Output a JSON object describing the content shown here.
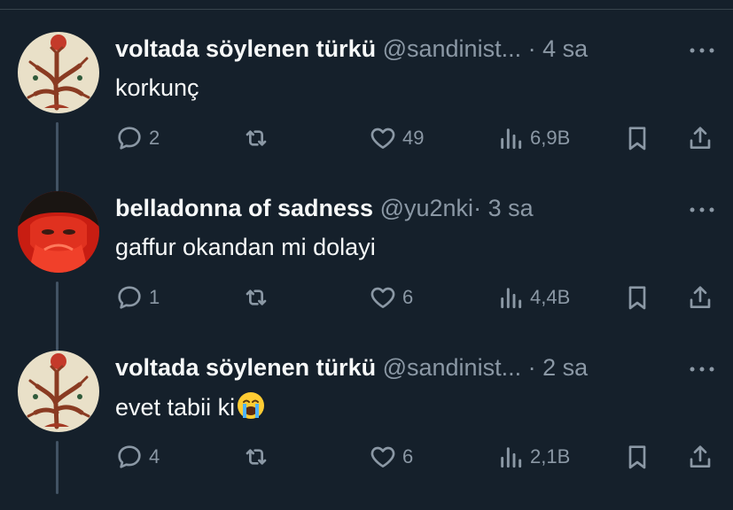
{
  "tweets": [
    {
      "name": "voltada söylenen türkü",
      "handle": "@sandinist...",
      "dot": "·",
      "time": "4 sa",
      "text": "korkunç",
      "replies": "2",
      "likes": "49",
      "views": "6,9B",
      "avatar": "tree-illustration-avatar"
    },
    {
      "name": "belladonna of sadness",
      "handle": "@yu2nki",
      "dot": "·",
      "time": "3 sa",
      "text": "gaffur okandan mi dolayi",
      "replies": "1",
      "likes": "6",
      "views": "4,4B",
      "avatar": "red-face-avatar"
    },
    {
      "name": "voltada söylenen türkü",
      "handle": "@sandinist...",
      "dot": "·",
      "time": "2 sa",
      "text": "evet tabii ki",
      "emoji": "crying-face-emoji",
      "replies": "4",
      "likes": "6",
      "views": "2,1B",
      "avatar": "tree-illustration-avatar"
    }
  ],
  "icons": {
    "reply": "reply-icon",
    "retweet": "retweet-icon",
    "like": "heart-icon",
    "views": "views-icon",
    "bookmark": "bookmark-icon",
    "share": "share-icon",
    "more": "more-icon"
  },
  "colors": {
    "background": "#15202b",
    "primary_text": "#f7f9f9",
    "secondary_text": "#8b98a5",
    "thread_line": "#425364"
  }
}
